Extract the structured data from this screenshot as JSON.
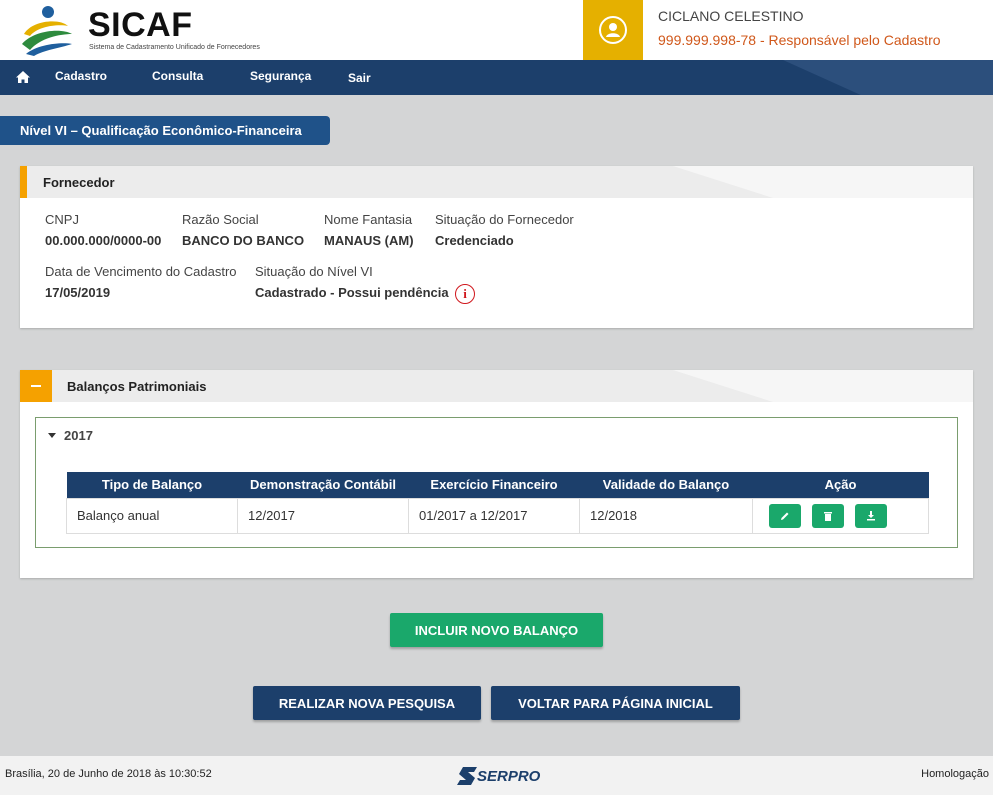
{
  "header": {
    "logo_title": "SICAF",
    "logo_subtitle": "Sistema de Cadastramento Unificado de Fornecedores",
    "user_name": "CICLANO CELESTINO",
    "user_role": "999.999.998-78 - Responsável pelo Cadastro"
  },
  "nav": {
    "items": [
      "Cadastro",
      "Consulta",
      "Segurança",
      "Sair"
    ]
  },
  "level_title": "Nível VI – Qualificação Econômico-Financeira",
  "fornecedor": {
    "title": "Fornecedor",
    "cnpj_label": "CNPJ",
    "cnpj": "00.000.000/0000-00",
    "razao_label": "Razão Social",
    "razao": "BANCO DO BANCO",
    "fantasia_label": "Nome Fantasia",
    "fantasia": "MANAUS (AM)",
    "situacao_label": "Situação do Fornecedor",
    "situacao": "Credenciado",
    "vencimento_label": "Data de Vencimento do Cadastro",
    "vencimento": "17/05/2019",
    "nivel_label": "Situação do Nível VI",
    "nivel": "Cadastrado - Possui pendência",
    "info_glyph": "i"
  },
  "balancos": {
    "title": "Balanços Patrimoniais",
    "year": "2017",
    "columns": [
      "Tipo de Balanço",
      "Demonstração Contábil",
      "Exercício Financeiro",
      "Validade do Balanço",
      "Ação"
    ],
    "rows": [
      [
        "Balanço anual",
        "12/2017",
        "01/2017 a 12/2017",
        "12/2018"
      ]
    ]
  },
  "buttons": {
    "incluir": "INCLUIR NOVO BALANÇO",
    "pesquisa": "REALIZAR NOVA PESQUISA",
    "voltar": "VOLTAR PARA PÁGINA INICIAL"
  },
  "footer": {
    "date": "Brasília, 20 de Junho de 2018 às 10:30:52",
    "brand": "SERPRO",
    "environment": "Homologação"
  },
  "colors": {
    "nav": "#1c3f6b",
    "accent": "#f5a100",
    "action_green": "#1aa86b",
    "user_role": "#d0581b"
  }
}
